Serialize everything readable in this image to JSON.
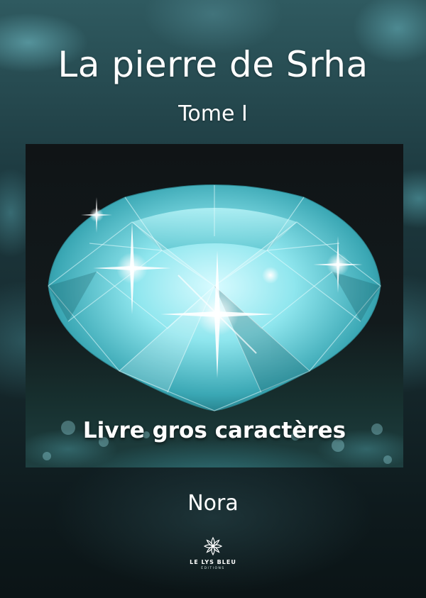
{
  "cover": {
    "title": "La pierre de Srha",
    "volume": "Tome I",
    "edition_note": "Livre gros caractères",
    "author": "Nora",
    "publisher": {
      "name": "LE LYS BLEU",
      "subtitle": "ÉDITIONS",
      "logo_icon": "lily-flower-icon"
    },
    "illustration": "diamond",
    "colors": {
      "text": "#ffffff",
      "diamond": "#8fe6ee",
      "background": "#1d3a40"
    }
  }
}
